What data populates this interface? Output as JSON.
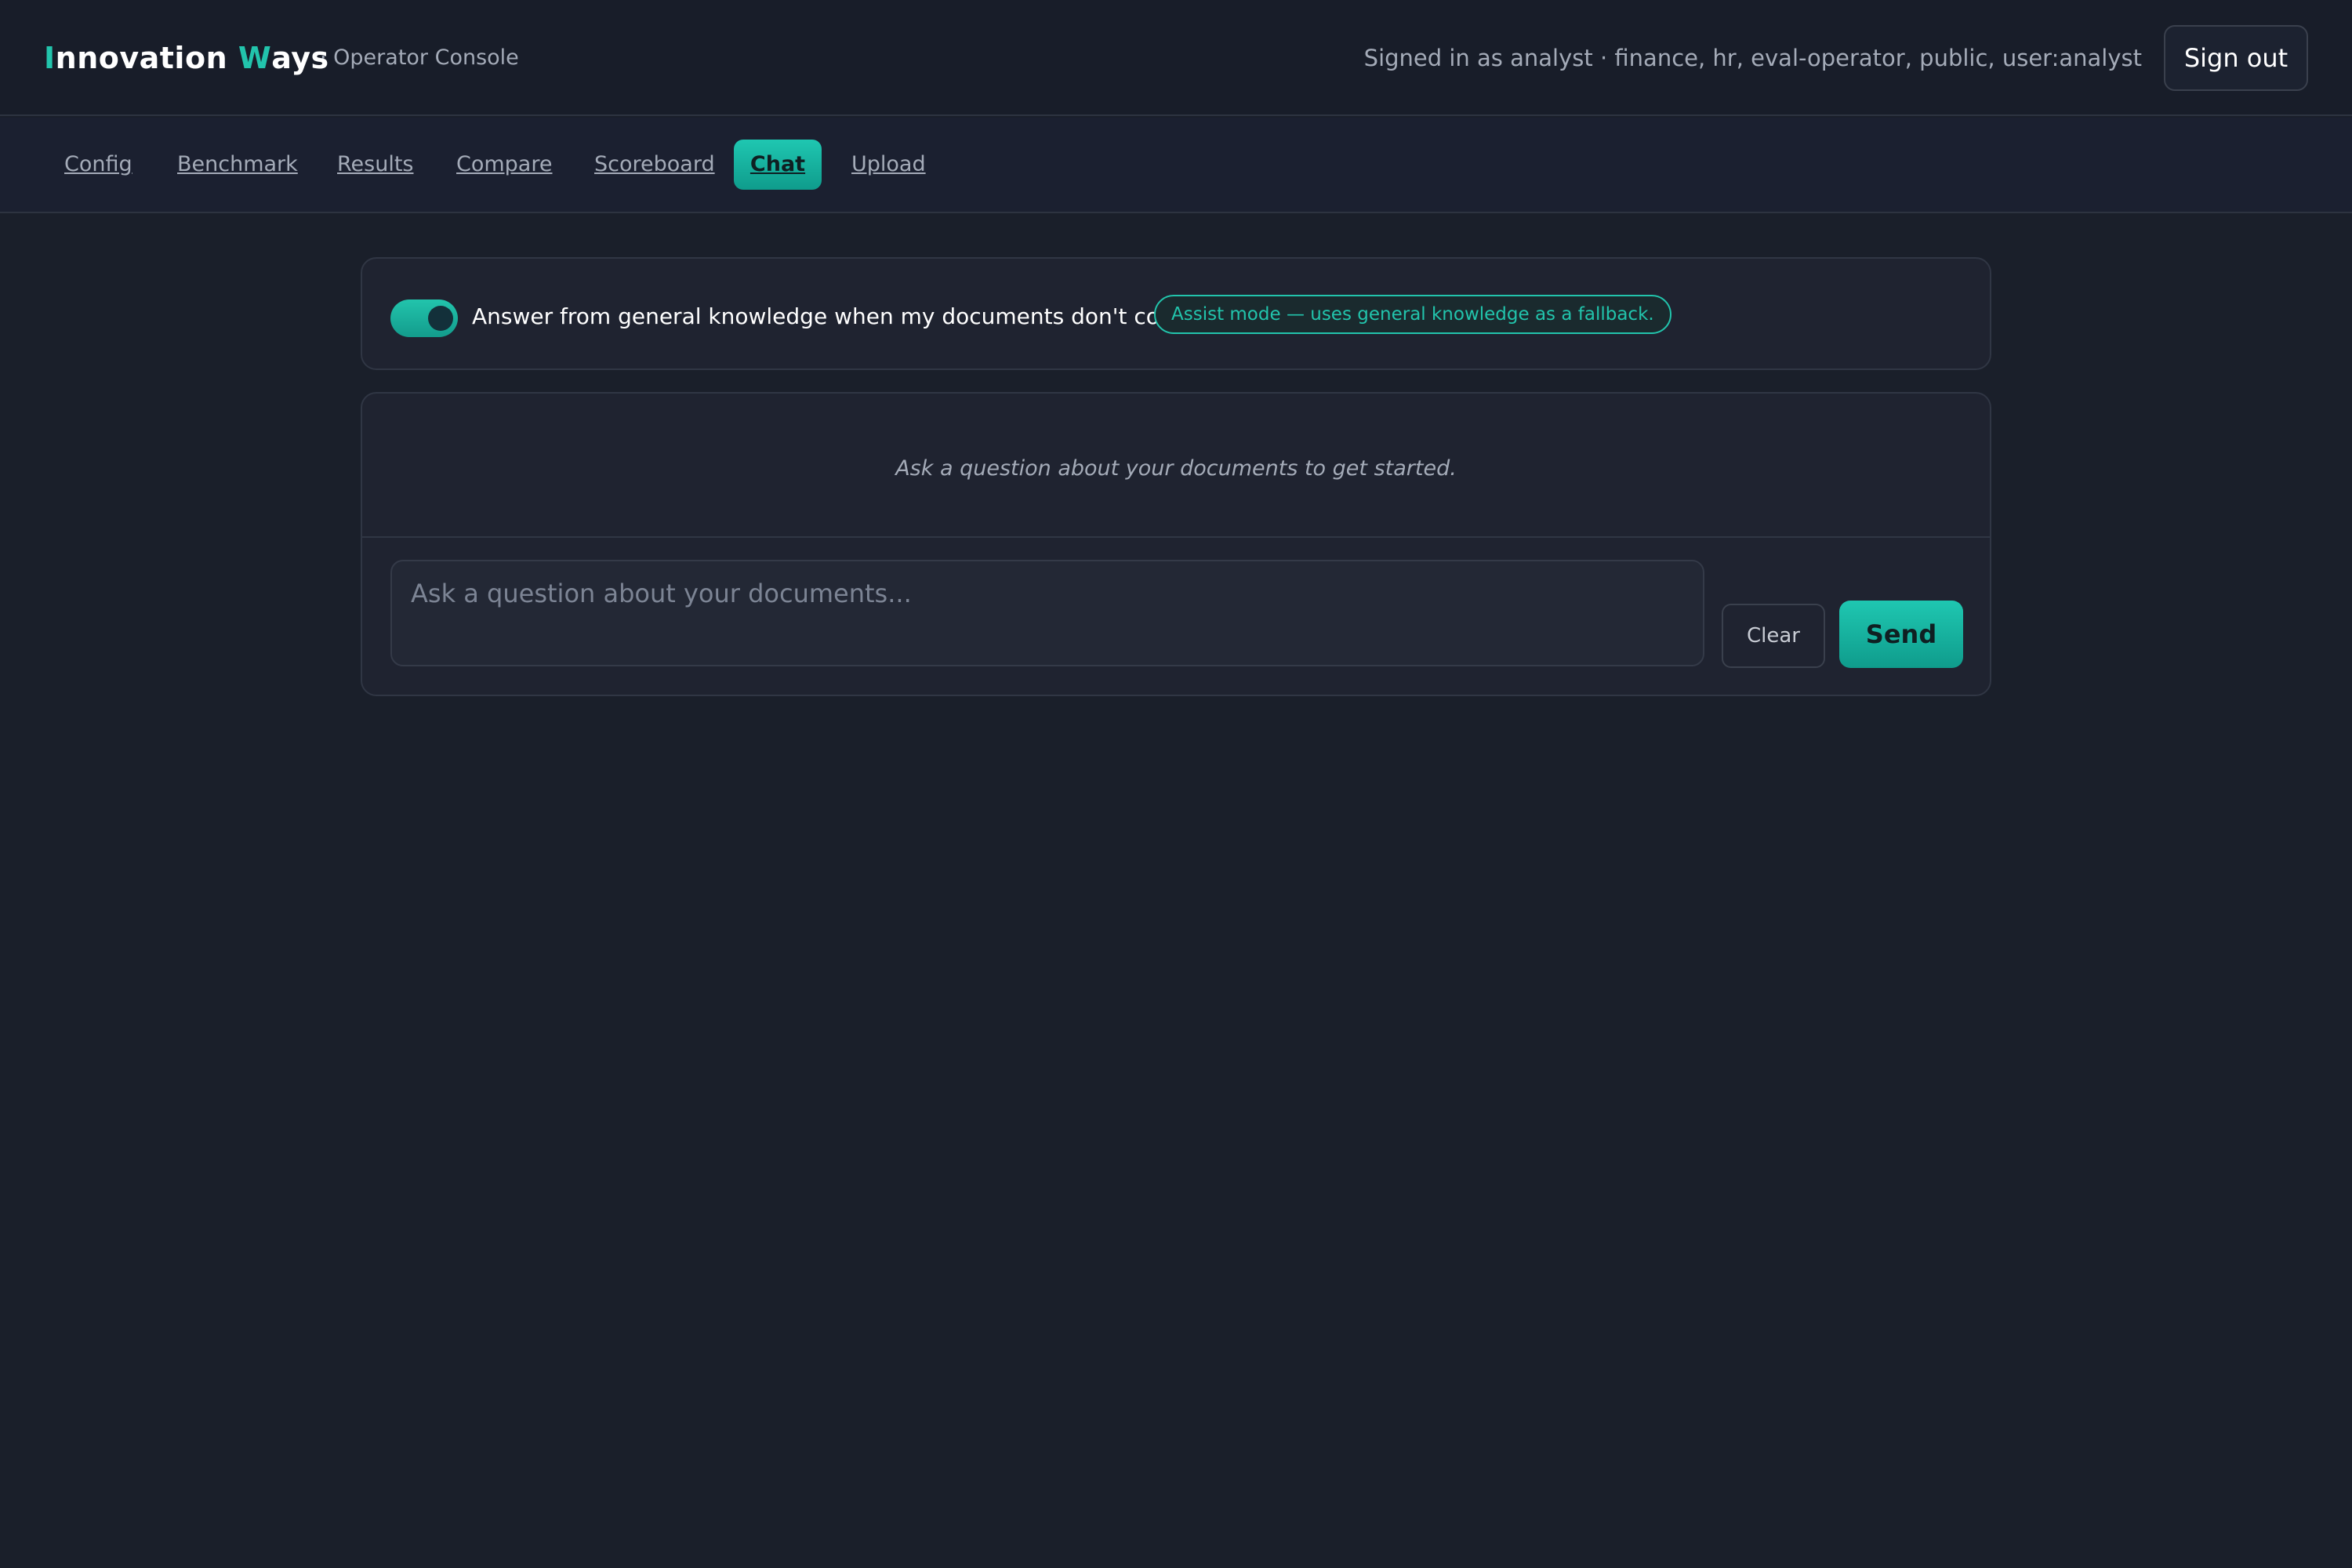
{
  "header": {
    "brand_part1_accent": "I",
    "brand_part1_rest": "nnovation ",
    "brand_part2_accent": "W",
    "brand_part2_rest": "ays",
    "subtitle": "· Operator Console",
    "signed_in_text": "Signed in as analyst · finance, hr, eval-operator, public, user:analyst",
    "sign_out_label": "Sign out"
  },
  "nav": {
    "items": [
      {
        "label": "Config"
      },
      {
        "label": "Benchmark"
      },
      {
        "label": "Results"
      },
      {
        "label": "Compare"
      },
      {
        "label": "Scoreboard"
      },
      {
        "label": "Chat",
        "active": true
      },
      {
        "label": "Upload"
      }
    ]
  },
  "assist": {
    "toggle_on": true,
    "toggle_label": "Answer from general knowledge when my documents don't cover it.",
    "badge_text": "Assist mode — uses general knowledge as a fallback."
  },
  "chat": {
    "empty_hint": "Ask a question about your documents to get started.",
    "input_value": "",
    "input_placeholder": "Ask a question about your documents...",
    "clear_label": "Clear",
    "send_label": "Send"
  },
  "colors": {
    "accent": "#22c4ac",
    "background": "#1a1f2a",
    "panel": "#1f2330"
  }
}
